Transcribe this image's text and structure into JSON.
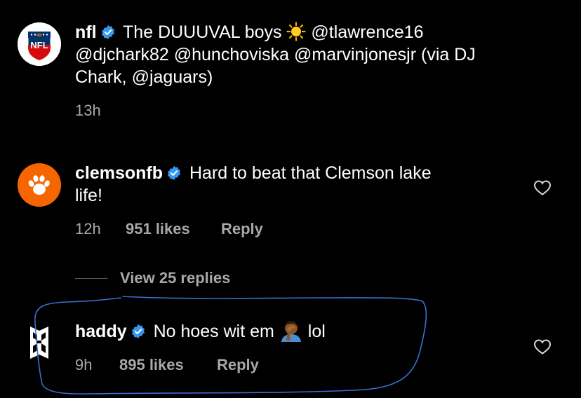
{
  "caption": {
    "username": "nfl",
    "text_before_emoji": " The DUUUVAL boys ",
    "emoji": "sun",
    "text_line1_end": " @tlawrence16",
    "text_line2": "@djchark82 @hunchoviska @marvinjonesjr (via DJ",
    "text_line3": "Chark, @jaguars)",
    "time": "13h",
    "avatar_icon": "nfl-shield-logo",
    "avatar_text": "NFL"
  },
  "comments": [
    {
      "username": "clemsonfb",
      "text_line1": " Hard to beat that Clemson lake",
      "text_line2": "life!",
      "time": "12h",
      "likes": "951 likes",
      "reply": "Reply",
      "avatar_icon": "paw-print-icon",
      "avatar_color": "#f56600"
    },
    {
      "username": "haddy",
      "text": " No hoes wit em ",
      "emoji": "person-facepalming",
      "text_end": " lol",
      "time": "9h",
      "likes": "895 likes",
      "reply": "Reply",
      "avatar_icon": "geometric-h-logo"
    }
  ],
  "view_replies": "View 25 replies",
  "colors": {
    "background": "#000000",
    "text": "#ffffff",
    "secondary": "#a8a8a8",
    "verified": "#3897f0",
    "annotation": "#3b6fd1"
  }
}
